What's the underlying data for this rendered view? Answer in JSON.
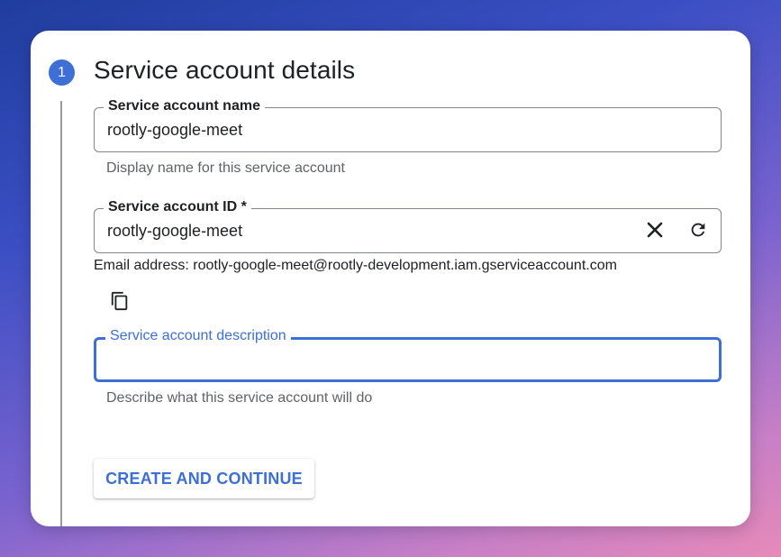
{
  "step": {
    "number": "1",
    "title": "Service account details"
  },
  "name_field": {
    "label": "Service account name",
    "value": "rootly-google-meet",
    "hint": "Display name for this service account"
  },
  "id_field": {
    "label": "Service account ID *",
    "value": "rootly-google-meet",
    "email": "Email address: rootly-google-meet@rootly-development.iam.gserviceaccount.com"
  },
  "description_field": {
    "label": "Service account description",
    "value": "",
    "hint": "Describe what this service account will do"
  },
  "actions": {
    "create_label": "CREATE AND CONTINUE"
  },
  "colors": {
    "accent": "#3d6fd6",
    "text": "#202124",
    "hint": "#5f6368"
  }
}
